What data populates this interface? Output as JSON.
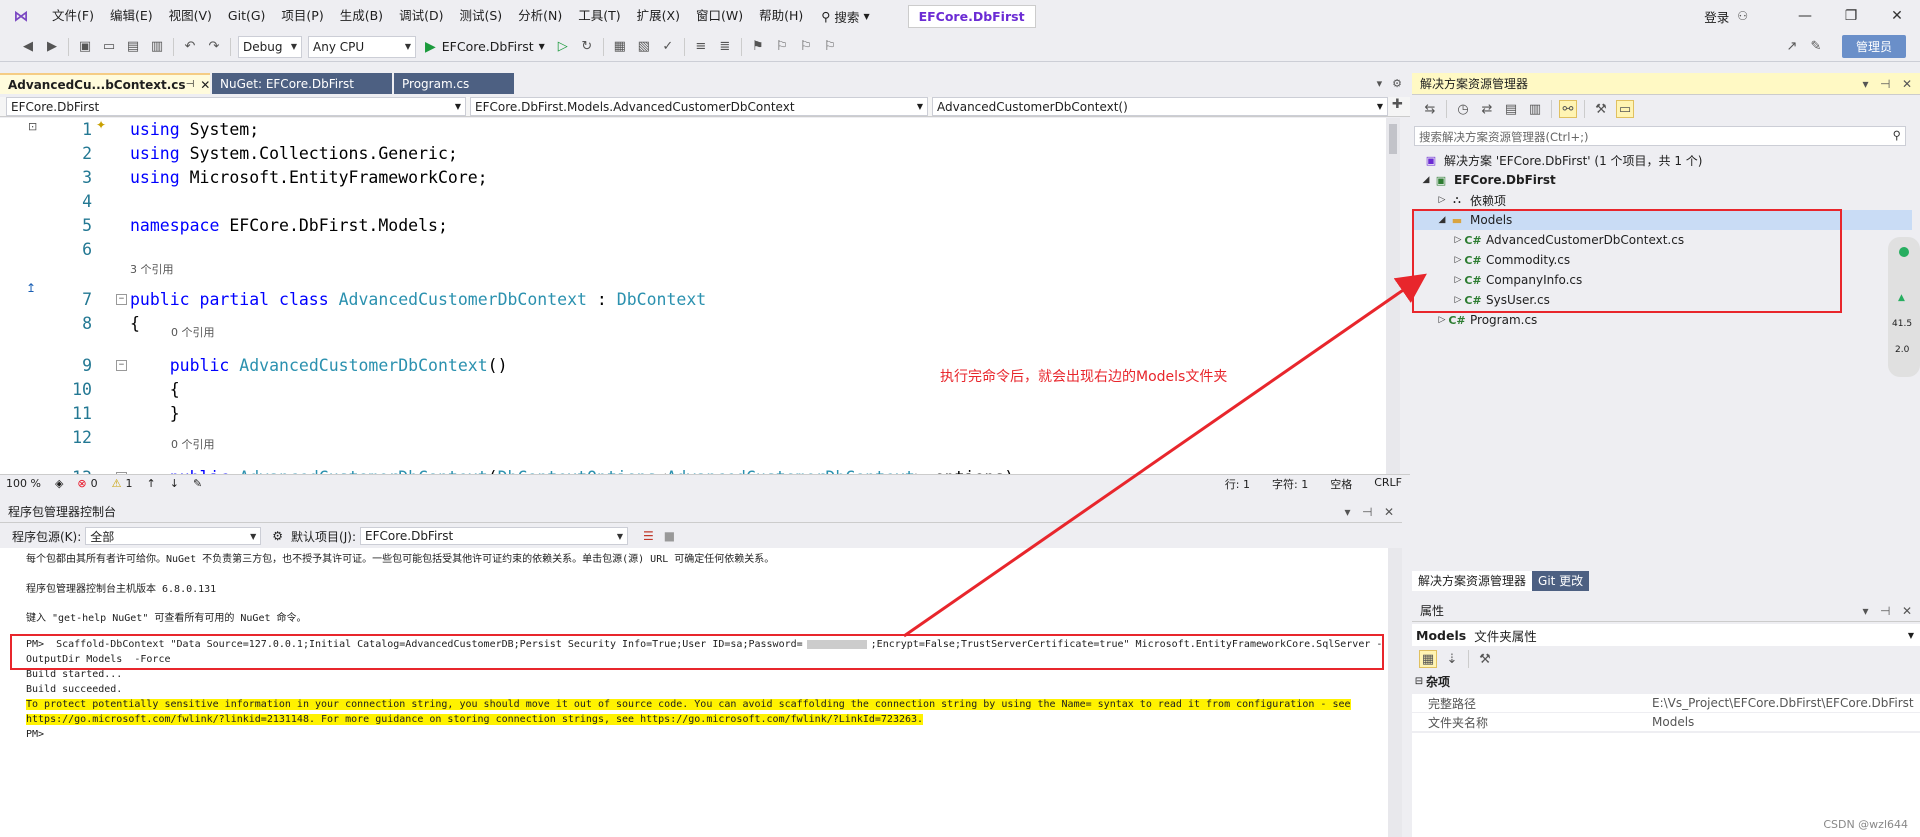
{
  "menubar": {
    "items": [
      "文件(F)",
      "编辑(E)",
      "视图(V)",
      "Git(G)",
      "项目(P)",
      "生成(B)",
      "调试(D)",
      "测试(S)",
      "分析(N)",
      "工具(T)",
      "扩展(X)",
      "窗口(W)",
      "帮助(H)"
    ],
    "search_label": "搜索",
    "project_name": "EFCore.DbFirst",
    "login": "登录"
  },
  "toolbar": {
    "config": "Debug",
    "platform": "Any CPU",
    "run_target": "EFCore.DbFirst",
    "admin": "管理员"
  },
  "editor": {
    "tabs": [
      "AdvancedCu...bContext.cs",
      "NuGet: EFCore.DbFirst",
      "Program.cs"
    ],
    "nav": [
      "EFCore.DbFirst",
      "EFCore.DbFirst.Models.AdvancedCustomerDbContext",
      "AdvancedCustomerDbContext()"
    ],
    "lines": [
      {
        "n": "1",
        "tokens": [
          {
            "c": "kw",
            "t": "using"
          },
          {
            "c": "tx",
            "t": " System;"
          }
        ]
      },
      {
        "n": "2",
        "tokens": [
          {
            "c": "kw",
            "t": "using"
          },
          {
            "c": "tx",
            "t": " System.Collections.Generic;"
          }
        ]
      },
      {
        "n": "3",
        "tokens": [
          {
            "c": "kw",
            "t": "using"
          },
          {
            "c": "tx",
            "t": " Microsoft.EntityFrameworkCore;"
          }
        ]
      },
      {
        "n": "4",
        "tokens": []
      },
      {
        "n": "5",
        "tokens": [
          {
            "c": "kw",
            "t": "namespace"
          },
          {
            "c": "tx",
            "t": " EFCore.DbFirst.Models;"
          }
        ]
      },
      {
        "n": "6",
        "tokens": []
      },
      {
        "n": "7",
        "tokens": [
          {
            "c": "kw",
            "t": "public partial class"
          },
          {
            "c": "tx",
            "t": " "
          },
          {
            "c": "ty",
            "t": "AdvancedCustomerDbContext"
          },
          {
            "c": "tx",
            "t": " : "
          },
          {
            "c": "ty",
            "t": "DbContext"
          }
        ]
      },
      {
        "n": "8",
        "tokens": [
          {
            "c": "tx",
            "t": "{"
          }
        ]
      },
      {
        "n": "9",
        "tokens": [
          {
            "c": "tx",
            "t": "    "
          },
          {
            "c": "kw",
            "t": "public"
          },
          {
            "c": "tx",
            "t": " "
          },
          {
            "c": "ty",
            "t": "AdvancedCustomerDbContext"
          },
          {
            "c": "tx",
            "t": "()"
          }
        ]
      },
      {
        "n": "10",
        "tokens": [
          {
            "c": "tx",
            "t": "    {"
          }
        ]
      },
      {
        "n": "11",
        "tokens": [
          {
            "c": "tx",
            "t": "    }"
          }
        ]
      },
      {
        "n": "12",
        "tokens": []
      },
      {
        "n": "13",
        "tokens": [
          {
            "c": "tx",
            "t": "    "
          },
          {
            "c": "kw",
            "t": "public"
          },
          {
            "c": "tx",
            "t": " "
          },
          {
            "c": "ty",
            "t": "AdvancedCustomerDbContext"
          },
          {
            "c": "tx",
            "t": "("
          },
          {
            "c": "ty",
            "t": "DbContextOptions"
          },
          {
            "c": "tx",
            "t": "<"
          },
          {
            "c": "ty",
            "t": "AdvancedCustomerDbContext"
          },
          {
            "c": "tx",
            "t": "> options)"
          }
        ]
      }
    ],
    "codelens_3refs": "3 个引用",
    "codelens_0refs_a": "0 个引用",
    "codelens_0refs_b": "0 个引用"
  },
  "statusbar": {
    "zoom": "100 %",
    "errors": "0",
    "warnings": "1",
    "line": "行: 1",
    "char": "字符: 1",
    "space": "空格",
    "eol": "CRLF"
  },
  "pmc": {
    "title": "程序包管理器控制台",
    "source_label": "程序包源(K):",
    "source_value": "全部",
    "default_project_label": "默认项目(J):",
    "default_project_value": "EFCore.DbFirst",
    "lines": [
      "每个包都由其所有者许可给你。NuGet 不负责第三方包，也不授予其许可证。一些包可能包括受其他许可证约束的依赖关系。单击包源(源) URL 可确定任何依赖关系。",
      "程序包管理器控制台主机版本 6.8.0.131",
      "键入 \"get-help NuGet\" 可查看所有可用的 NuGet 命令。",
      "PM>  Scaffold-DbContext \"Data Source=127.0.0.1;Initial Catalog=AdvancedCustomerDB;Persist Security Info=True;User ID=sa;Password=",
      ";Encrypt=False;TrustServerCertificate=true\" Microsoft.EntityFrameworkCore.SqlServer -",
      "OutputDir Models  -Force",
      "Build started...",
      "Build succeeded.",
      "To protect potentially sensitive information in your connection string, you should move it out of source code. You can avoid scaffolding the connection string by using the Name= syntax to read it from configuration - see",
      "https://go.microsoft.com/fwlink/?linkid=2131148. For more guidance on storing connection strings, see https://go.microsoft.com/fwlink/?LinkId=723263.",
      "PM>"
    ]
  },
  "solution_explorer": {
    "title": "解决方案资源管理器",
    "search_placeholder": "搜索解决方案资源管理器(Ctrl+;)",
    "solution": "解决方案 'EFCore.DbFirst' (1 个项目，共 1 个)",
    "project": "EFCore.DbFirst",
    "deps": "依赖项",
    "models": "Models",
    "files": [
      "AdvancedCustomerDbContext.cs",
      "Commodity.cs",
      "CompanyInfo.cs",
      "SysUser.cs"
    ],
    "program": "Program.cs",
    "tab_se": "解决方案资源管理器",
    "tab_git": "Git 更改"
  },
  "properties": {
    "title": "属性",
    "object": "Models",
    "object_desc": "文件夹属性",
    "category": "杂项",
    "rows": [
      {
        "k": "完整路径",
        "v": "E:\\Vs_Project\\EFCore.DbFirst\\EFCore.DbFirst"
      },
      {
        "k": "文件夹名称",
        "v": "Models"
      }
    ]
  },
  "annotation": "执行完命令后，就会出现右边的Models文件夹",
  "watermark": "CSDN @wzl644",
  "side_widget": [
    "41.5",
    "2.0"
  ],
  "colors": {
    "accent": "#e8262c",
    "keyword": "#0000ff",
    "type": "#2b91af",
    "highlight": "#fff200"
  }
}
